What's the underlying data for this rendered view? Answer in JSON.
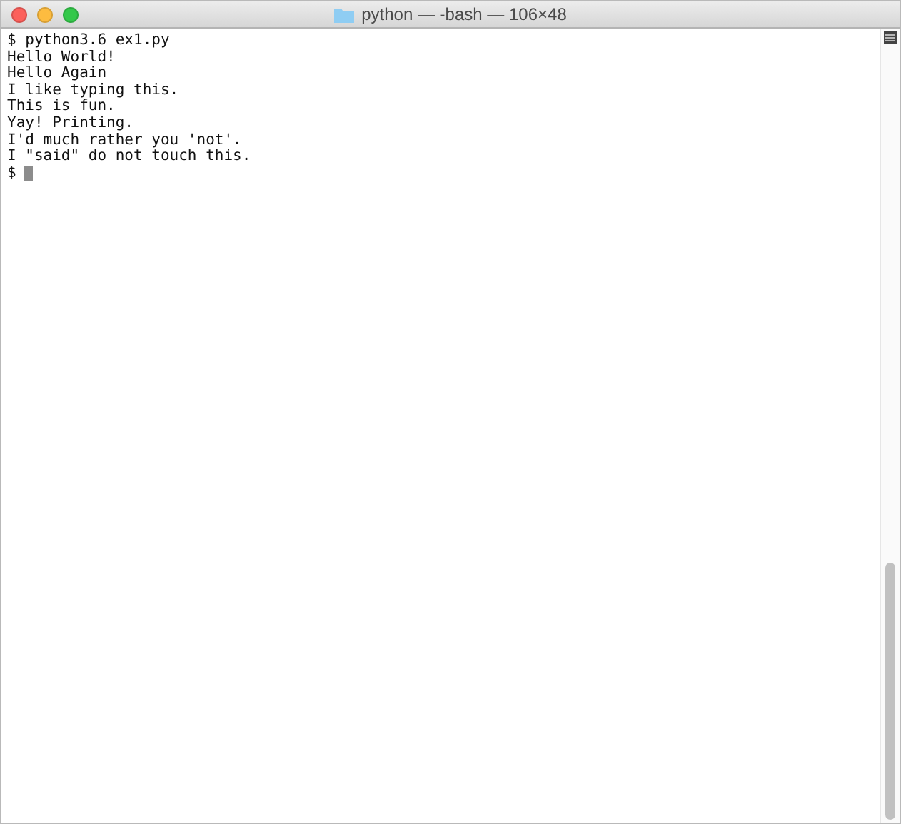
{
  "window": {
    "title": "python — -bash — 106×48"
  },
  "lines": [
    "$ python3.6 ex1.py",
    "Hello World!",
    "Hello Again",
    "I like typing this.",
    "This is fun.",
    "Yay! Printing.",
    "I'd much rather you 'not'.",
    "I \"said\" do not touch this."
  ],
  "prompt": "$"
}
